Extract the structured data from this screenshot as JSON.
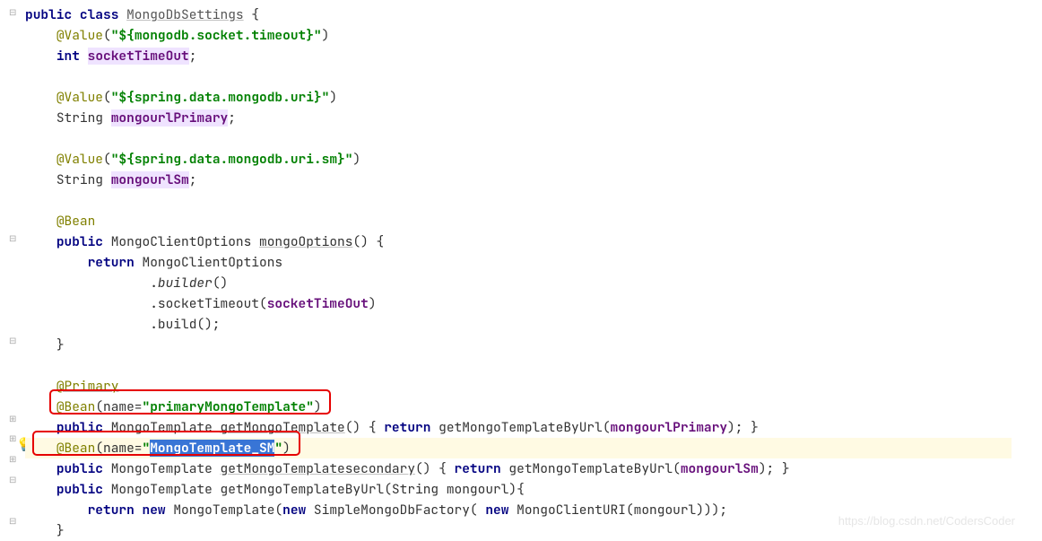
{
  "code": {
    "l1_public": "public",
    "l1_class": "class",
    "l1_name": "MongoDbSettings",
    "l1_brace": " {",
    "l2_ann": "@Value",
    "l2_par1": "(",
    "l2_q1": "\"",
    "l2_str": "${mongodb.socket.timeout}",
    "l2_q2": "\"",
    "l2_par2": ")",
    "l3_int": "int",
    "l3_field": "socketTimeOut",
    "l3_semi": ";",
    "l5_ann": "@Value",
    "l5_par1": "(",
    "l5_q1": "\"",
    "l5_str": "${spring.data.mongodb.uri}",
    "l5_q2": "\"",
    "l5_par2": ")",
    "l6_type": "String ",
    "l6_field": "mongourlPrimary",
    "l6_semi": ";",
    "l8_ann": "@Value",
    "l8_par1": "(",
    "l8_q1": "\"",
    "l8_str": "${spring.data.mongodb.uri.sm}",
    "l8_q2": "\"",
    "l8_par2": ")",
    "l9_type": "String ",
    "l9_field": "mongourlSm",
    "l9_semi": ";",
    "l11_ann": "@Bean",
    "l12_public": "public",
    "l12_type": " MongoClientOptions ",
    "l12_method": "mongoOptions",
    "l12_rest": "() {",
    "l13_return": "return",
    "l13_rest": " MongoClientOptions",
    "l14_a": ".",
    "l14_builder": "builder",
    "l14_b": "()",
    "l15_a": ".socketTimeout(",
    "l15_field": "socketTimeOut",
    "l15_b": ")",
    "l16": ".build();",
    "l17": "}",
    "l19_ann": "@Primary",
    "l20_ann": "@Bean",
    "l20_a": "(name=",
    "l20_q1": "\"",
    "l20_str": "primaryMongoTemplate",
    "l20_q2": "\"",
    "l20_b": ")",
    "l21_public": "public",
    "l21_type": " MongoTemplate ",
    "l21_method": "getMongoTemplate",
    "l21_a": "() { ",
    "l21_return": "return",
    "l21_b": " getMongoTemplateByUrl(",
    "l21_field": "mongourlPrimary",
    "l21_c": "); }",
    "l22_ann": "@Bean",
    "l22_a": "(name=",
    "l22_q1": "\"",
    "l22_str": "MongoTemplate_SM",
    "l22_q2": "\"",
    "l22_b": ")",
    "l23_public": "public",
    "l23_type": " MongoTemplate ",
    "l23_method": "getMongoTemplatesecondary",
    "l23_a": "() { ",
    "l23_return": "return",
    "l23_b": " getMongoTemplateByUrl(",
    "l23_field": "mongourlSm",
    "l23_c": "); }",
    "l24_public": "public",
    "l24_a": " MongoTemplate getMongoTemplateByUrl(String mongourl){",
    "l25_return": "return",
    "l25_new1": "new",
    "l25_a": " MongoTemplate(",
    "l25_new2": "new",
    "l25_b": " SimpleMongoDbFactory( ",
    "l25_new3": "new",
    "l25_c": " MongoClientURI(mongourl)));",
    "l26": "}"
  },
  "watermark": "https://blog.csdn.net/CodersCoder"
}
